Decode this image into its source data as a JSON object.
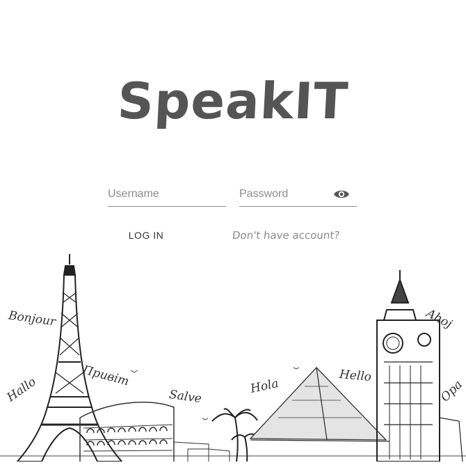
{
  "app": {
    "logo_text": "SpeakIT"
  },
  "login_form": {
    "username_placeholder": "Username",
    "password_placeholder": "Password",
    "login_label": "LOG IN",
    "register_link": "Don't have account?"
  },
  "illustration": {
    "greetings": [
      "Bonjour",
      "Hallo",
      "Привіт",
      "Salve",
      "Hola",
      "Hello",
      "Ahoj",
      "Opa"
    ]
  },
  "icons": {
    "password_toggle": "eye-icon"
  }
}
